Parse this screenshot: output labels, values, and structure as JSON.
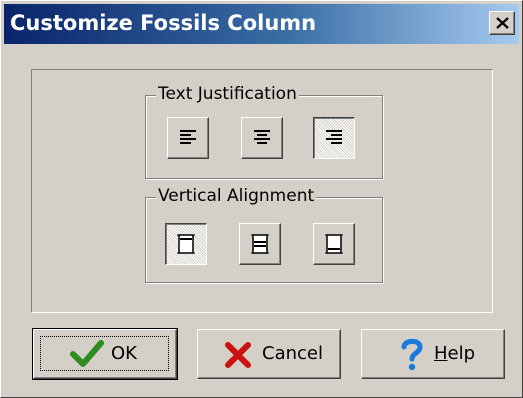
{
  "window": {
    "title": "Customize Fossils Column",
    "close_icon": "close-icon"
  },
  "text_justification": {
    "label": "Text Justification",
    "options": [
      {
        "name": "align-left",
        "icon": "align-left-icon"
      },
      {
        "name": "align-center",
        "icon": "align-center-icon"
      },
      {
        "name": "align-right",
        "icon": "align-right-icon"
      }
    ],
    "selected": "align-right"
  },
  "vertical_alignment": {
    "label": "Vertical Alignment",
    "options": [
      {
        "name": "align-top",
        "icon": "align-top-icon"
      },
      {
        "name": "align-middle",
        "icon": "align-middle-icon"
      },
      {
        "name": "align-bottom",
        "icon": "align-bottom-icon"
      }
    ],
    "selected": "align-top"
  },
  "buttons": {
    "ok": {
      "label": "OK",
      "icon": "checkmark-icon"
    },
    "cancel": {
      "label": "Cancel",
      "icon": "x-icon"
    },
    "help": {
      "label_underlined": "H",
      "label_rest": "elp",
      "icon": "question-mark-icon"
    }
  },
  "colors": {
    "title_gradient_start": "#0a246a",
    "title_gradient_end": "#a6caf0",
    "face": "#d4d0c8",
    "ok_check": "#2e8b1e",
    "cancel_x": "#cc1111",
    "help_q": "#1a7ad8"
  }
}
